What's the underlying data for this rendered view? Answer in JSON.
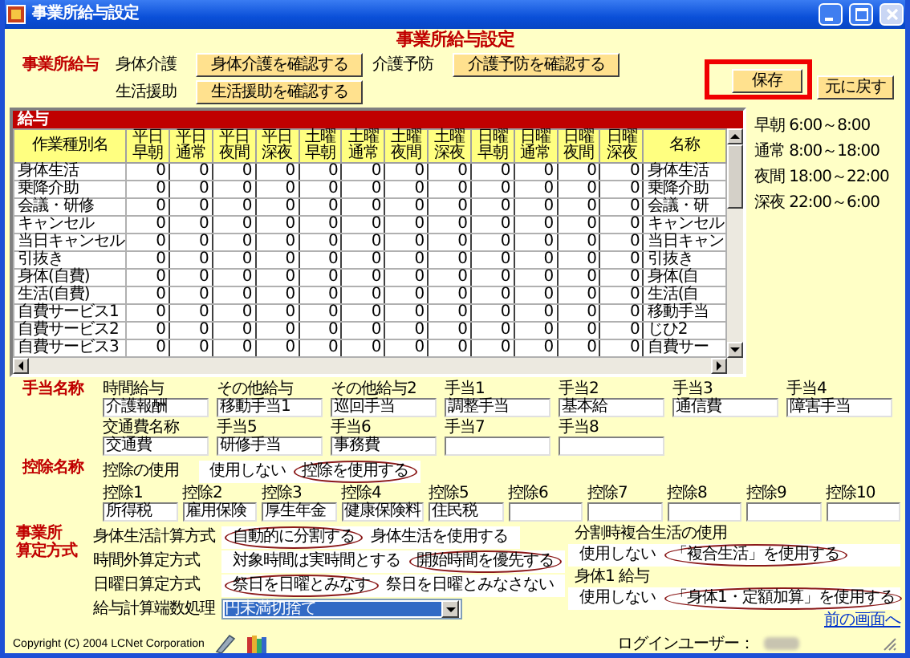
{
  "window": {
    "title": "事業所給与設定"
  },
  "heading": "事業所給与設定",
  "salary": {
    "label": "事業所給与",
    "items": [
      {
        "label": "身体介護",
        "button": "身体介護を確認する"
      },
      {
        "label": "介護予防",
        "button": "介護予防を確認する"
      },
      {
        "label": "生活援助",
        "button": "生活援助を確認する"
      }
    ]
  },
  "actions": [
    {
      "label": "保存",
      "highlighted": true
    },
    {
      "label": "元に戻す",
      "highlighted": false
    }
  ],
  "table": {
    "title": "給与",
    "columns": [
      "作業種別名",
      "平日早朝",
      "平日通常",
      "平日夜間",
      "平日深夜",
      "土曜早朝",
      "土曜通常",
      "土曜夜間",
      "土曜深夜",
      "日曜早朝",
      "日曜通常",
      "日曜夜間",
      "日曜深夜",
      "名称"
    ],
    "rows": [
      [
        "身体生活",
        "0",
        "0",
        "0",
        "0",
        "0",
        "0",
        "0",
        "0",
        "0",
        "0",
        "0",
        "0",
        "身体生活"
      ],
      [
        "乗降介助",
        "0",
        "0",
        "0",
        "0",
        "0",
        "0",
        "0",
        "0",
        "0",
        "0",
        "0",
        "0",
        "乗降介助"
      ],
      [
        "会議・研修",
        "0",
        "0",
        "0",
        "0",
        "0",
        "0",
        "0",
        "0",
        "0",
        "0",
        "0",
        "0",
        "会議・研"
      ],
      [
        "キャンセル",
        "0",
        "0",
        "0",
        "0",
        "0",
        "0",
        "0",
        "0",
        "0",
        "0",
        "0",
        "0",
        "キャンセル"
      ],
      [
        "当日キャンセル",
        "0",
        "0",
        "0",
        "0",
        "0",
        "0",
        "0",
        "0",
        "0",
        "0",
        "0",
        "0",
        "当日キャン"
      ],
      [
        "引抜き",
        "0",
        "0",
        "0",
        "0",
        "0",
        "0",
        "0",
        "0",
        "0",
        "0",
        "0",
        "0",
        "引抜き"
      ],
      [
        "身体(自費)",
        "0",
        "0",
        "0",
        "0",
        "0",
        "0",
        "0",
        "0",
        "0",
        "0",
        "0",
        "0",
        "身体(自"
      ],
      [
        "生活(自費)",
        "0",
        "0",
        "0",
        "0",
        "0",
        "0",
        "0",
        "0",
        "0",
        "0",
        "0",
        "0",
        "生活(自"
      ],
      [
        "自費サービス1",
        "0",
        "0",
        "0",
        "0",
        "0",
        "0",
        "0",
        "0",
        "0",
        "0",
        "0",
        "0",
        "移動手当"
      ],
      [
        "自費サービス2",
        "0",
        "0",
        "0",
        "0",
        "0",
        "0",
        "0",
        "0",
        "0",
        "0",
        "0",
        "0",
        "じひ2"
      ],
      [
        "自費サービス3",
        "0",
        "0",
        "0",
        "0",
        "0",
        "0",
        "0",
        "0",
        "0",
        "0",
        "0",
        "0",
        "自費サー"
      ]
    ]
  },
  "time_legend": [
    "早朝 6:00～8:00",
    "通常 8:00～18:00",
    "夜間 18:00～22:00",
    "深夜 22:00～6:00"
  ],
  "allowances": {
    "label": "手当名称",
    "rows": [
      [
        {
          "label": "時間給与",
          "value": "介護報酬"
        },
        {
          "label": "その他給与",
          "value": "移動手当1"
        },
        {
          "label": "その他給与2",
          "value": "巡回手当"
        },
        {
          "label": "手当1",
          "value": "調整手当"
        },
        {
          "label": "手当2",
          "value": "基本給"
        },
        {
          "label": "手当3",
          "value": "通信費"
        },
        {
          "label": "手当4",
          "value": "障害手当"
        }
      ],
      [
        {
          "label": "交通費名称",
          "value": "交通費"
        },
        {
          "label": "手当5",
          "value": "研修手当"
        },
        {
          "label": "手当6",
          "value": "事務費"
        },
        {
          "label": "手当7"
        },
        {
          "label": "手当8"
        }
      ]
    ]
  },
  "deductions": {
    "label": "控除名称",
    "use": {
      "label": "控除の使用",
      "options": [
        {
          "label": "使用しない",
          "selected": false
        },
        {
          "label": "控除を使用する",
          "selected": true
        }
      ]
    },
    "fields": [
      {
        "label": "控除1",
        "value": "所得税"
      },
      {
        "label": "控除2",
        "value": "雇用保険"
      },
      {
        "label": "控除3",
        "value": "厚生年金"
      },
      {
        "label": "控除4",
        "value": "健康保険料"
      },
      {
        "label": "控除5",
        "value": "住民税"
      },
      {
        "label": "控除6"
      },
      {
        "label": "控除7"
      },
      {
        "label": "控除8"
      },
      {
        "label": "控除9"
      },
      {
        "label": "控除10"
      }
    ]
  },
  "calculation": {
    "label_lines": [
      "事業所",
      "算定方式"
    ],
    "methods": [
      {
        "label": "身体生活計算方式",
        "options": [
          {
            "label": "自動的に分割する",
            "selected": true
          },
          {
            "label": "身体生活を使用する",
            "selected": false
          }
        ]
      },
      {
        "label": "時間外算定方式",
        "options": [
          {
            "label": "対象時間は実時間とする",
            "selected": false
          },
          {
            "label": "開始時間を優先する",
            "selected": true
          }
        ]
      },
      {
        "label": "日曜日算定方式",
        "options": [
          {
            "label": "祭日を日曜とみなす",
            "selected": true
          },
          {
            "label": "祭日を日曜とみなさない",
            "selected": false
          }
        ]
      }
    ],
    "rounding": {
      "label": "給与計算端数処理",
      "value": "円未満切捨て"
    },
    "side": [
      {
        "label": "分割時複合生活の使用",
        "options": [
          {
            "label": "使用しない",
            "selected": false
          },
          {
            "label": "「複合生活」を使用する",
            "selected": true
          }
        ]
      },
      {
        "label": "身体1 給与",
        "options": [
          {
            "label": "使用しない",
            "selected": false
          },
          {
            "label": "「身体1・定額加算」を使用する",
            "selected": true
          }
        ]
      }
    ],
    "link": "前の画面へ"
  },
  "footer": {
    "copyright": "Copyright (C) 2004 LCNet Corporation",
    "login_label": "ログインユーザー："
  }
}
